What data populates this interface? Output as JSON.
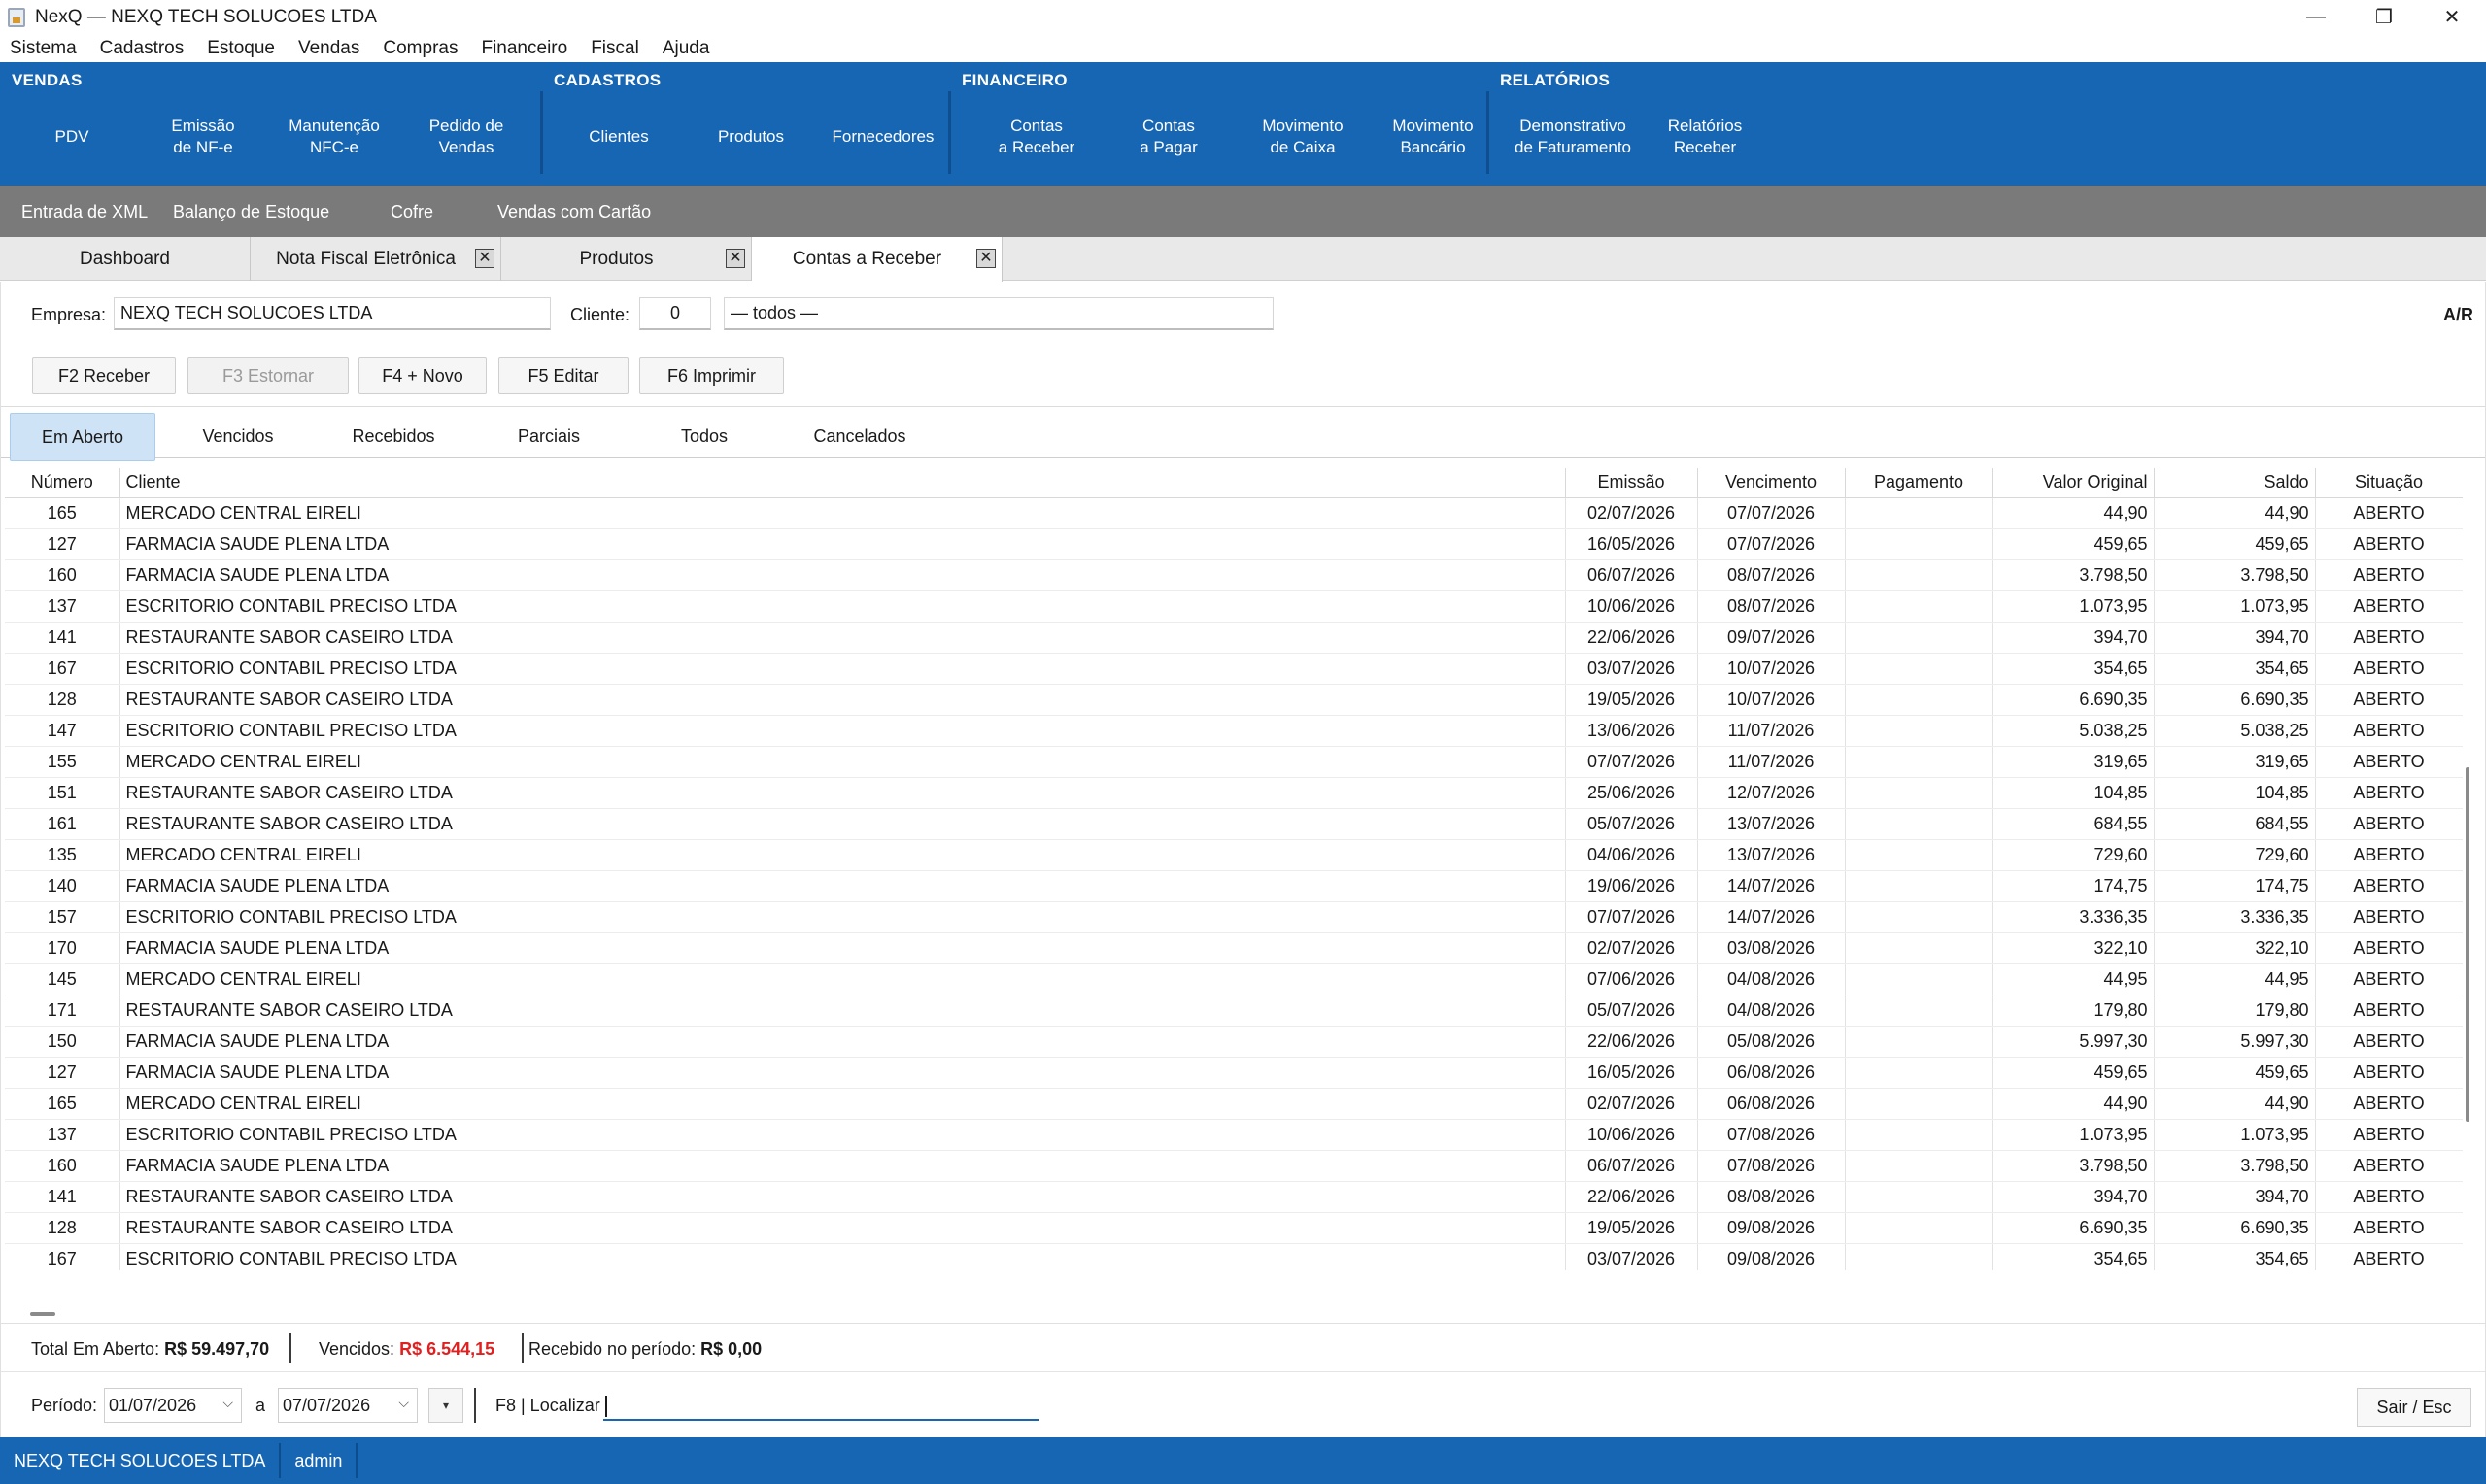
{
  "window": {
    "title": "NexQ — NEXQ TECH SOLUCOES LTDA",
    "controls": {
      "minimize": "—",
      "maximize": "❐",
      "close": "✕"
    }
  },
  "menu": [
    "Sistema",
    "Cadastros",
    "Estoque",
    "Vendas",
    "Compras",
    "Financeiro",
    "Fiscal",
    "Ajuda"
  ],
  "ribbon": {
    "vendas": {
      "title": "VENDAS",
      "buttons": [
        "PDV",
        "Emissão\nde NF-e",
        "Manutenção\nNFC-e",
        "Pedido de\nVendas"
      ]
    },
    "cadastros": {
      "title": "CADASTROS",
      "buttons": [
        "Clientes",
        "Produtos",
        "Fornecedores"
      ]
    },
    "financeiro": {
      "title": "FINANCEIRO",
      "buttons": [
        "Contas\na Receber",
        "Contas\na Pagar",
        "Movimento\nde Caixa",
        "Movimento\nBancário"
      ]
    },
    "relatorios": {
      "title": "RELATÓRIOS",
      "buttons": [
        "Demonstrativo\nde Faturamento",
        "Relatórios\nReceber"
      ]
    }
  },
  "quickbar": [
    "Entrada de XML",
    "Balanço de Estoque",
    "Cofre",
    "Vendas com Cartão"
  ],
  "tabs": [
    {
      "label": "Dashboard",
      "closable": false
    },
    {
      "label": "Nota Fiscal Eletrônica",
      "closable": true
    },
    {
      "label": "Produtos",
      "closable": true
    },
    {
      "label": "Contas a Receber",
      "closable": true,
      "active": true
    }
  ],
  "tab_close_glyph": "✕",
  "form": {
    "empresa_label": "Empresa:",
    "empresa_value": "NEXQ TECH SOLUCOES LTDA",
    "cliente_label": "Cliente:",
    "cliente_code": "0",
    "cliente_name": "— todos —",
    "tag": "A/R"
  },
  "toolbar": {
    "receber": "F2  Receber",
    "estornar": "F3  Estornar",
    "novo": "F4  + Novo",
    "editar": "F5  Editar",
    "imprimir": "F6  Imprimir"
  },
  "filters": [
    "Em Aberto",
    "Vencidos",
    "Recebidos",
    "Parciais",
    "Todos",
    "Cancelados"
  ],
  "table": {
    "columns": [
      "Número",
      "Cliente",
      "Emissão",
      "Vencimento",
      "Pagamento",
      "Valor Original",
      "Saldo",
      "Situação"
    ],
    "rows": [
      [
        "165",
        "MERCADO CENTRAL EIRELI",
        "02/07/2026",
        "07/07/2026",
        "",
        "44,90",
        "44,90",
        "ABERTO"
      ],
      [
        "127",
        "FARMACIA SAUDE PLENA LTDA",
        "16/05/2026",
        "07/07/2026",
        "",
        "459,65",
        "459,65",
        "ABERTO"
      ],
      [
        "160",
        "FARMACIA SAUDE PLENA LTDA",
        "06/07/2026",
        "08/07/2026",
        "",
        "3.798,50",
        "3.798,50",
        "ABERTO"
      ],
      [
        "137",
        "ESCRITORIO CONTABIL PRECISO LTDA",
        "10/06/2026",
        "08/07/2026",
        "",
        "1.073,95",
        "1.073,95",
        "ABERTO"
      ],
      [
        "141",
        "RESTAURANTE SABOR CASEIRO LTDA",
        "22/06/2026",
        "09/07/2026",
        "",
        "394,70",
        "394,70",
        "ABERTO"
      ],
      [
        "167",
        "ESCRITORIO CONTABIL PRECISO LTDA",
        "03/07/2026",
        "10/07/2026",
        "",
        "354,65",
        "354,65",
        "ABERTO"
      ],
      [
        "128",
        "RESTAURANTE SABOR CASEIRO LTDA",
        "19/05/2026",
        "10/07/2026",
        "",
        "6.690,35",
        "6.690,35",
        "ABERTO"
      ],
      [
        "147",
        "ESCRITORIO CONTABIL PRECISO LTDA",
        "13/06/2026",
        "11/07/2026",
        "",
        "5.038,25",
        "5.038,25",
        "ABERTO"
      ],
      [
        "155",
        "MERCADO CENTRAL EIRELI",
        "07/07/2026",
        "11/07/2026",
        "",
        "319,65",
        "319,65",
        "ABERTO"
      ],
      [
        "151",
        "RESTAURANTE SABOR CASEIRO LTDA",
        "25/06/2026",
        "12/07/2026",
        "",
        "104,85",
        "104,85",
        "ABERTO"
      ],
      [
        "161",
        "RESTAURANTE SABOR CASEIRO LTDA",
        "05/07/2026",
        "13/07/2026",
        "",
        "684,55",
        "684,55",
        "ABERTO"
      ],
      [
        "135",
        "MERCADO CENTRAL EIRELI",
        "04/06/2026",
        "13/07/2026",
        "",
        "729,60",
        "729,60",
        "ABERTO"
      ],
      [
        "140",
        "FARMACIA SAUDE PLENA LTDA",
        "19/06/2026",
        "14/07/2026",
        "",
        "174,75",
        "174,75",
        "ABERTO"
      ],
      [
        "157",
        "ESCRITORIO CONTABIL PRECISO LTDA",
        "07/07/2026",
        "14/07/2026",
        "",
        "3.336,35",
        "3.336,35",
        "ABERTO"
      ],
      [
        "170",
        "FARMACIA SAUDE PLENA LTDA",
        "02/07/2026",
        "03/08/2026",
        "",
        "322,10",
        "322,10",
        "ABERTO"
      ],
      [
        "145",
        "MERCADO CENTRAL EIRELI",
        "07/06/2026",
        "04/08/2026",
        "",
        "44,95",
        "44,95",
        "ABERTO"
      ],
      [
        "171",
        "RESTAURANTE SABOR CASEIRO LTDA",
        "05/07/2026",
        "04/08/2026",
        "",
        "179,80",
        "179,80",
        "ABERTO"
      ],
      [
        "150",
        "FARMACIA SAUDE PLENA LTDA",
        "22/06/2026",
        "05/08/2026",
        "",
        "5.997,30",
        "5.997,30",
        "ABERTO"
      ],
      [
        "127",
        "FARMACIA SAUDE PLENA LTDA",
        "16/05/2026",
        "06/08/2026",
        "",
        "459,65",
        "459,65",
        "ABERTO"
      ],
      [
        "165",
        "MERCADO CENTRAL EIRELI",
        "02/07/2026",
        "06/08/2026",
        "",
        "44,90",
        "44,90",
        "ABERTO"
      ],
      [
        "137",
        "ESCRITORIO CONTABIL PRECISO LTDA",
        "10/06/2026",
        "07/08/2026",
        "",
        "1.073,95",
        "1.073,95",
        "ABERTO"
      ],
      [
        "160",
        "FARMACIA SAUDE PLENA LTDA",
        "06/07/2026",
        "07/08/2026",
        "",
        "3.798,50",
        "3.798,50",
        "ABERTO"
      ],
      [
        "141",
        "RESTAURANTE SABOR CASEIRO LTDA",
        "22/06/2026",
        "08/08/2026",
        "",
        "394,70",
        "394,70",
        "ABERTO"
      ],
      [
        "128",
        "RESTAURANTE SABOR CASEIRO LTDA",
        "19/05/2026",
        "09/08/2026",
        "",
        "6.690,35",
        "6.690,35",
        "ABERTO"
      ],
      [
        "167",
        "ESCRITORIO CONTABIL PRECISO LTDA",
        "03/07/2026",
        "09/08/2026",
        "",
        "354,65",
        "354,65",
        "ABERTO"
      ]
    ]
  },
  "totals": {
    "aberto_label": "Total Em Aberto:",
    "aberto_value": "R$ 59.497,70",
    "vencidos_label": "Vencidos:",
    "vencidos_value": "R$ 6.544,15",
    "recebido_label": "Recebido no período:",
    "recebido_value": "R$ 0,00"
  },
  "period": {
    "label": "Período:",
    "from": "01/07/2026",
    "to_label": "a",
    "to": "07/07/2026",
    "menu_glyph": "▾",
    "search_label": "F8 | Localizar",
    "search_value": "",
    "exit": "Sair / Esc"
  },
  "status": {
    "company": "NEXQ TECH SOLUCOES LTDA",
    "user": "admin"
  },
  "colors": {
    "ribbon": "#1766b3",
    "quickbar": "#7a7a7a",
    "active_filter": "#cfe3f7",
    "overdue": "#e02020"
  }
}
